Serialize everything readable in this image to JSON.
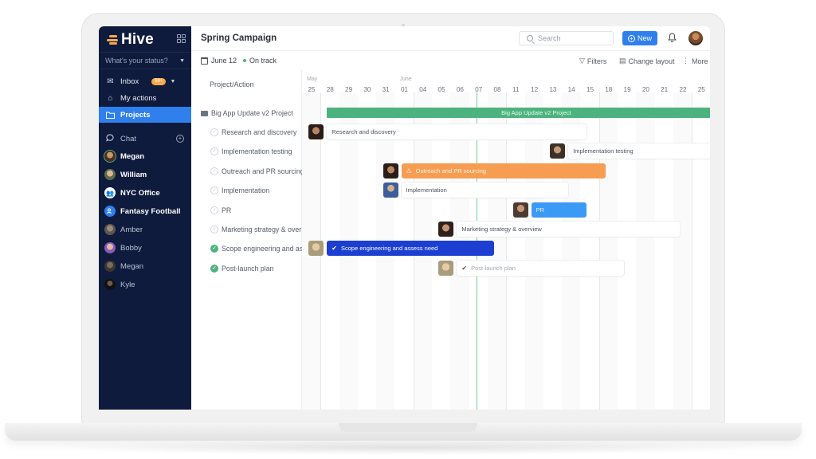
{
  "app": {
    "brand": "Hive",
    "accent": "#2f80ed",
    "sidebar_bg": "#0e1b3d"
  },
  "sidebar": {
    "status_placeholder": "What's your status?",
    "nav": [
      {
        "label": "Inbox",
        "icon": "mail-icon",
        "badge": "99+"
      },
      {
        "label": "My actions",
        "icon": "home-icon"
      },
      {
        "label": "Projects",
        "icon": "folder-icon",
        "active": true
      }
    ],
    "chat_label": "Chat",
    "chats": [
      {
        "label": "Megan",
        "bold": true
      },
      {
        "label": "William",
        "bold": true
      },
      {
        "label": "NYC Office",
        "bold": true
      },
      {
        "label": "Fantasy Football",
        "bold": true
      },
      {
        "label": "Amber",
        "bold": false
      },
      {
        "label": "Bobby",
        "bold": false
      },
      {
        "label": "Megan",
        "bold": false
      },
      {
        "label": "Kyle",
        "bold": false
      }
    ]
  },
  "header": {
    "title": "Spring Campaign",
    "search_placeholder": "Search",
    "new_label": "New",
    "date": "June 12",
    "status": "On track",
    "tools": {
      "filters": "Filters",
      "layout": "Change layout",
      "more": "More"
    }
  },
  "list": {
    "column_header": "Project/Action",
    "project": "Big App Update v2 Project",
    "tasks": [
      {
        "label": "Research and discovery",
        "done": false
      },
      {
        "label": "Implementation testing",
        "done": false
      },
      {
        "label": "Outreach and PR sourcing",
        "done": false
      },
      {
        "label": "Implementation",
        "done": false
      },
      {
        "label": "PR",
        "done": false
      },
      {
        "label": "Marketing strategy & over",
        "done": false
      },
      {
        "label": "Scope engineering and as",
        "done": true
      },
      {
        "label": "Post-launch plan",
        "done": true
      }
    ]
  },
  "timeline": {
    "months": [
      {
        "label": "May",
        "at": 0
      },
      {
        "label": "June",
        "at": 5
      }
    ],
    "days": [
      "25",
      "28",
      "29",
      "30",
      "31",
      "01",
      "04",
      "05",
      "06",
      "07",
      "08",
      "11",
      "12",
      "13",
      "14",
      "15",
      "18",
      "19",
      "20",
      "21",
      "22",
      "25"
    ],
    "today_index": 9,
    "project_bar": {
      "label": "Big App Update v2 Project",
      "start": 1,
      "end": 22,
      "color": "#4db37e"
    },
    "bars": [
      {
        "label": "Research and discovery",
        "start": 1,
        "end": 15,
        "style": "white",
        "icon": ""
      },
      {
        "label": "Implementation testing",
        "start": 14,
        "end": 22,
        "style": "white",
        "icon": ""
      },
      {
        "label": "Outreach and PR sourcing",
        "start": 5,
        "end": 16,
        "style": "orange",
        "color": "#f79d52",
        "icon": "warning-icon"
      },
      {
        "label": "Implementation",
        "start": 5,
        "end": 14,
        "style": "white",
        "icon": ""
      },
      {
        "label": "PR",
        "start": 12,
        "end": 15,
        "style": "blue",
        "color": "#3b9af5",
        "icon": ""
      },
      {
        "label": "Marketing strategy & overview",
        "start": 8,
        "end": 20,
        "style": "white",
        "icon": ""
      },
      {
        "label": "Scope engineering and assess need",
        "start": 1,
        "end": 10,
        "style": "darkblue",
        "color": "#1c3fd1",
        "icon": "check-icon"
      },
      {
        "label": "Post-launch plan",
        "start": 8,
        "end": 17,
        "style": "white-muted",
        "icon": "check-icon"
      }
    ]
  }
}
